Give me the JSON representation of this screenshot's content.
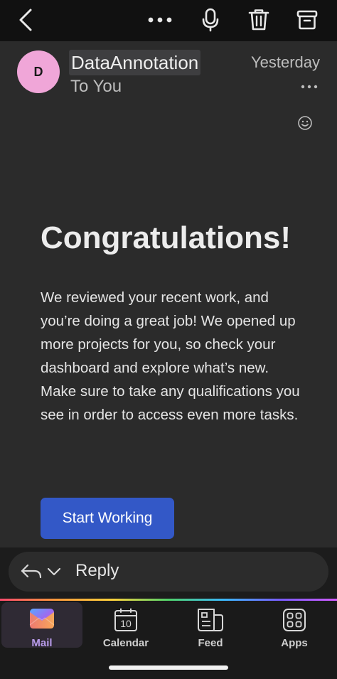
{
  "toolbar": {
    "back_icon": "chevron-left-icon",
    "more_icon": "more-horizontal-icon",
    "mic_icon": "microphone-icon",
    "delete_icon": "trash-icon",
    "archive_icon": "archive-icon"
  },
  "message": {
    "avatar_initial": "D",
    "avatar_color": "#f0a6d8",
    "sender": "DataAnnotation",
    "recipient": "To You",
    "date": "Yesterday",
    "heading": "Congratulations!",
    "body": "We reviewed your recent work, and you’re doing a great job! We opened up more projects for you, so check your dashboard and explore what’s new. Make sure to take any qualifications you see in order to access even more tasks.",
    "cta_label": "Start Working",
    "cta_color": "#3358c7"
  },
  "reply": {
    "label": "Reply"
  },
  "tabs": [
    {
      "label": "Mail",
      "icon": "mail-icon",
      "active": true
    },
    {
      "label": "Calendar",
      "icon": "calendar-icon",
      "day": "10"
    },
    {
      "label": "Feed",
      "icon": "feed-icon"
    },
    {
      "label": "Apps",
      "icon": "apps-icon"
    }
  ],
  "colors": {
    "active_tab_label": "#b89bea",
    "background": "#2b2b2b"
  }
}
